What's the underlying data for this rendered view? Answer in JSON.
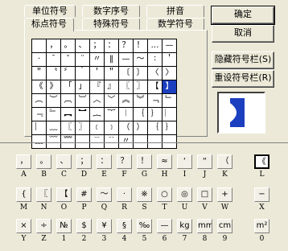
{
  "tabs_row1": [
    "单位符号",
    "数字序号",
    "拼音"
  ],
  "tabs_row2": [
    "标点符号",
    "特殊符号",
    "数学符号"
  ],
  "buttons": {
    "ok": "确定",
    "cancel": "取消",
    "hide": "隐藏符号栏(S)",
    "reset": "重设符号栏(R)"
  },
  "grid": [
    [
      "",
      "，",
      "。",
      "、",
      "；",
      "：",
      "？",
      "！",
      "…",
      "—"
    ],
    [
      "·",
      "ˉ",
      "ˇ",
      "¨",
      "〃",
      "‖",
      "—",
      "～",
      "∶",
      "＇"
    ],
    [
      "＂",
      "〝",
      "〞",
      "｀",
      "＇",
      "＂",
      "〔",
      "〕",
      "〈",
      "〉"
    ],
    [
      "《",
      "》",
      "「",
      "」",
      "『",
      "』",
      "〖",
      "〗",
      "【",
      "】"
    ],
    [
      "︵",
      "︶",
      "︹",
      "︺",
      "︿",
      "﹀",
      "︽",
      "︾",
      "﹁",
      "﹂"
    ],
    [
      "﹃",
      "﹄",
      "︻",
      "︼",
      "︷",
      "︸",
      "︱",
      "｛",
      "｝",
      "︳"
    ],
    [
      "︴",
      "﹏",
      "〖",
      "〗",
      "﹝",
      "﹞",
      "（",
      "）",
      "｛",
      "｝"
    ],
    [
      "﹏",
      "﹋",
      "﹌",
      "﹍",
      "﹉",
      "﹊",
      "〃",
      "",
      "",
      ""
    ]
  ],
  "preview_symbol": "】",
  "keyboard_rows": [
    {
      "keys": [
        "，",
        "。",
        "、",
        "；",
        "：",
        "？",
        "！",
        "≈",
        "‘",
        "“",
        "（",
        "《"
      ],
      "labels": [
        "A",
        "B",
        "C",
        "D",
        "E",
        "F",
        "G",
        "H",
        "I",
        "J",
        "K",
        "L"
      ]
    },
    {
      "keys": [
        "{",
        "〖",
        "【",
        "#",
        "～",
        "·",
        "※",
        "○",
        "◎",
        "□",
        "+",
        "−"
      ],
      "labels": [
        "M",
        "N",
        "O",
        "P",
        "Q",
        "R",
        "S",
        "T",
        "U",
        "V",
        "W",
        "X"
      ]
    },
    {
      "keys": [
        "×",
        "÷",
        "№",
        "$",
        "¥",
        "§",
        "‰",
        "—",
        "kg",
        "mm",
        "cm",
        "m²"
      ],
      "labels": [
        "Y",
        "Z",
        "1",
        "2",
        "3",
        "4",
        "5",
        "6",
        "7",
        "8",
        "9",
        "0"
      ]
    }
  ]
}
